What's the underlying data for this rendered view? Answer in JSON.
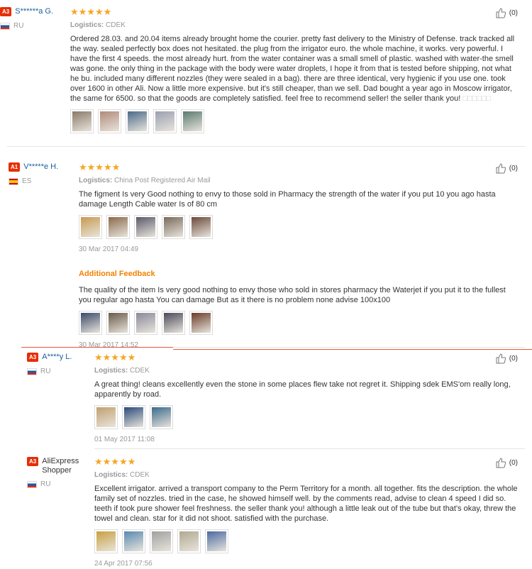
{
  "reviews": [
    {
      "badge": "A3",
      "name": "S******a G.",
      "country": "RU",
      "stars": "★★★★★",
      "logistics_label": "Logistics:",
      "logistics": "CDEK",
      "text": "Ordered 28.03. and 20.04 items already brought home the courier. pretty fast delivery to the Ministry of Defense. track tracked all the way. sealed perfectly box does not hesitated. the plug from the irrigator euro. the whole machine, it works. very powerful. I have the first 4 speeds. the most already hurt. from the water container was a small smell of plastic. washed with water-the smell was gone. the only thing in the package with the body were water droplets, I hope it from that is tested before shipping, not what he bu. included many different nozzles (they were sealed in a bag). there are three identical, very hygienic if you use one. took over 1600 in other Ali. Now a little more expensive. but it's still cheaper, than we sell. Dad bought a year ago in Moscow irrigator, the same for 6500. so that the goods are completely satisfied. feel free to recommend seller! the seller thank you!",
      "text_tail": "□□□□□□",
      "helpful": "(0)"
    },
    {
      "badge": "A1",
      "name": "V*****e H.",
      "country": "ES",
      "stars": "★★★★★",
      "logistics_label": "Logistics:",
      "logistics": "China Post Registered Air Mail",
      "text": "The figment Is very Good nothing to envy to those sold in Pharmacy the strength of the water if you put 10 you ago hasta damage Length Cable water Is of 80 cm",
      "date": "30 Mar 2017 04:49",
      "additional_label": "Additional Feedback",
      "additional_text": "The quality of the item Is very good nothing to envy those who sold in stores pharmacy the Waterjet if you put it to the fullest you regular ago hasta You can damage But as it there is no problem none advise 100x100",
      "additional_date": "30 Mar 2017 14:52",
      "helpful": "(0)"
    },
    {
      "badge": "A3",
      "name": "A****y L.",
      "country": "RU",
      "stars": "★★★★★",
      "logistics_label": "Logistics:",
      "logistics": "CDEK",
      "text": "A great thing! cleans excellently even the stone in some places flew take not regret it. Shipping sdek EMS'om really long, apparently by road.",
      "date": "01 May 2017 11:08",
      "helpful": "(0)"
    },
    {
      "badge": "A3",
      "name": "AliExpress Shopper",
      "country": "RU",
      "stars": "★★★★★",
      "logistics_label": "Logistics:",
      "logistics": "CDEK",
      "text": "Excellent irrigator. arrived a transport company to the Perm Territory for a month. all together. fits the description. the whole family set of nozzles. tried in the case, he showed himself well. by the comments read, advise to clean 4 speed I did so. teeth if took pure shower feel freshness. the seller thank you! although a little leak out of the tube but that's okay, threw the towel and clean. star for it did not shoot. satisfied with the purchase.",
      "date": "24 Apr 2017 07:56",
      "helpful": "(0)"
    }
  ],
  "photo_colors": {
    "r1": [
      "#8a7a6a",
      "#b08a7a",
      "#4a6a8a",
      "#9aa0b0",
      "#5a7a70"
    ],
    "r2": [
      "#c89a50",
      "#8a6a4a",
      "#5a5a6a",
      "#7a6a5a",
      "#6a4a3a"
    ],
    "r2b": [
      "#3a4a6a",
      "#6a5a4a",
      "#8a8a9a",
      "#4a4a5a",
      "#6a3a2a"
    ],
    "r3": [
      "#c0a070",
      "#2a4a7a",
      "#3a6a8a"
    ],
    "r4": [
      "#c8a040",
      "#5a8ab0",
      "#a0a0a0",
      "#b0a890",
      "#4a6aa0"
    ]
  }
}
